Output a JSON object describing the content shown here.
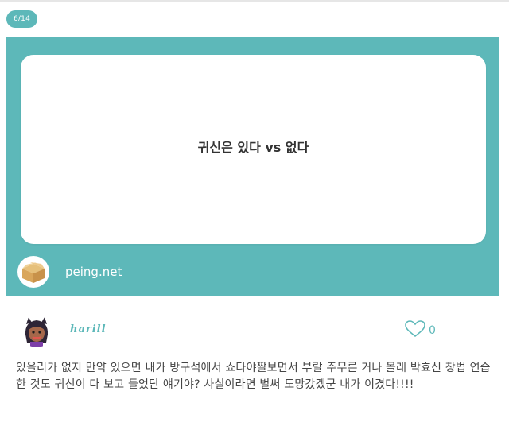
{
  "badge": {
    "counter": "6/14"
  },
  "card": {
    "question": "귀신은 있다 vs 없다",
    "site": "peing.net"
  },
  "answer": {
    "username": "harill",
    "likes": "0",
    "text": "있을리가 없지 만약 있으면 내가 방구석에서 쇼타야짤보면서 부랄 주무른 거나 몰래 박효신 창법 연습한 것도 귀신이 다 보고 들었단 얘기야? 사실이라면 벌써 도망갔겠군 내가 이겼다!!!!"
  },
  "icons": {
    "site_logo": "cardboard-box-icon",
    "like": "heart-icon",
    "avatar": "anime-character-avatar"
  },
  "colors": {
    "accent": "#5db8b9",
    "text": "#444444",
    "question_text": "#333333"
  }
}
